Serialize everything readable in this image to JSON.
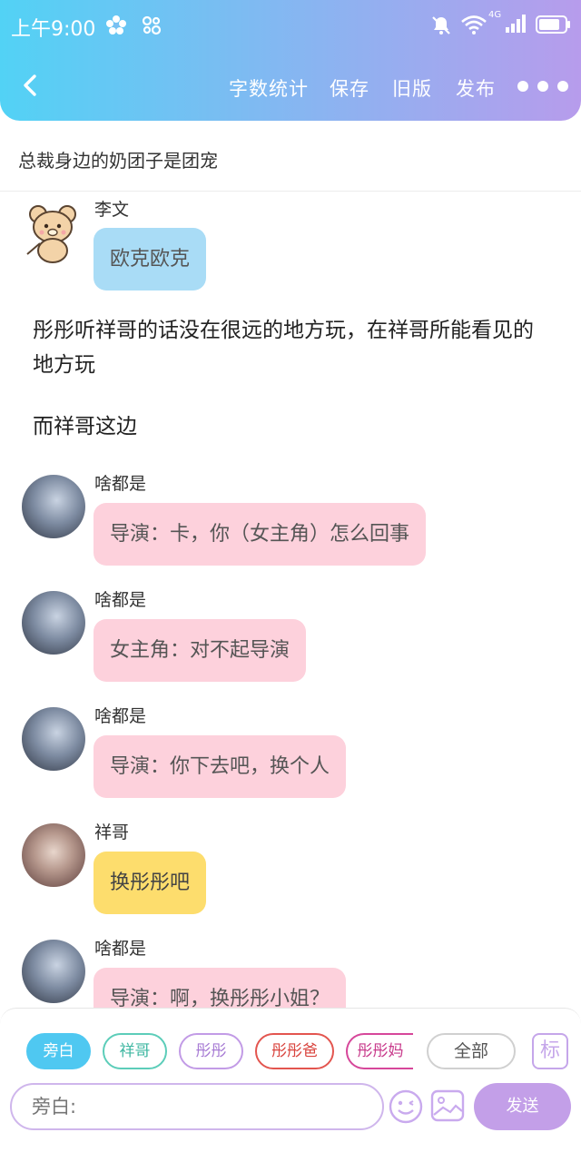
{
  "status_bar": {
    "time": "上午9:00",
    "network": "4G"
  },
  "toolbar": {
    "word_count": "字数统计",
    "save": "保存",
    "old_version": "旧版",
    "publish": "发布"
  },
  "story": {
    "title": "总裁身边的奶团子是团宠"
  },
  "messages": [
    {
      "type": "chat",
      "sender": "李文",
      "text": "欧克欧克",
      "bubble_color": "#a9dcf6",
      "avatar": "bear-avatar"
    },
    {
      "type": "narration",
      "text": "彤彤听祥哥的话没在很远的地方玩，在祥哥所能看见的地方玩"
    },
    {
      "type": "narration",
      "text": "而祥哥这边"
    },
    {
      "type": "chat",
      "sender": "啥都是",
      "text": "导演：卡，你（女主角）怎么回事",
      "bubble_color": "#fdd1dc",
      "avatar": "girl-avatar"
    },
    {
      "type": "chat",
      "sender": "啥都是",
      "text": "女主角：对不起导演",
      "bubble_color": "#fdd1dc",
      "avatar": "girl-avatar"
    },
    {
      "type": "chat",
      "sender": "啥都是",
      "text": "导演：你下去吧，换个人",
      "bubble_color": "#fdd1dc",
      "avatar": "girl-avatar"
    },
    {
      "type": "chat",
      "sender": "祥哥",
      "text": "换彤彤吧",
      "bubble_color": "#fddd6d",
      "avatar": "boy-avatar"
    },
    {
      "type": "chat",
      "sender": "啥都是",
      "text": "导演：啊，换彤彤小姐？",
      "bubble_color": "#fdd1dc",
      "avatar": "girl-avatar"
    }
  ],
  "role_chips": [
    {
      "label": "旁白",
      "color": "#4fc8f1",
      "active": true
    },
    {
      "label": "祥哥",
      "color": "#5ccdb9",
      "active": false
    },
    {
      "label": "彤彤",
      "color": "#c29be6",
      "active": false
    },
    {
      "label": "彤彤爸",
      "color": "#e3554f",
      "active": false
    },
    {
      "label": "彤彤妈",
      "color": "#d6479a",
      "active": false
    },
    {
      "label": "全部",
      "color": "#d0d0d0",
      "active": false
    },
    {
      "label": "标",
      "color": "#c5a6ea",
      "active": false
    }
  ],
  "composer": {
    "placeholder": "旁白:",
    "send_label": "发送"
  }
}
